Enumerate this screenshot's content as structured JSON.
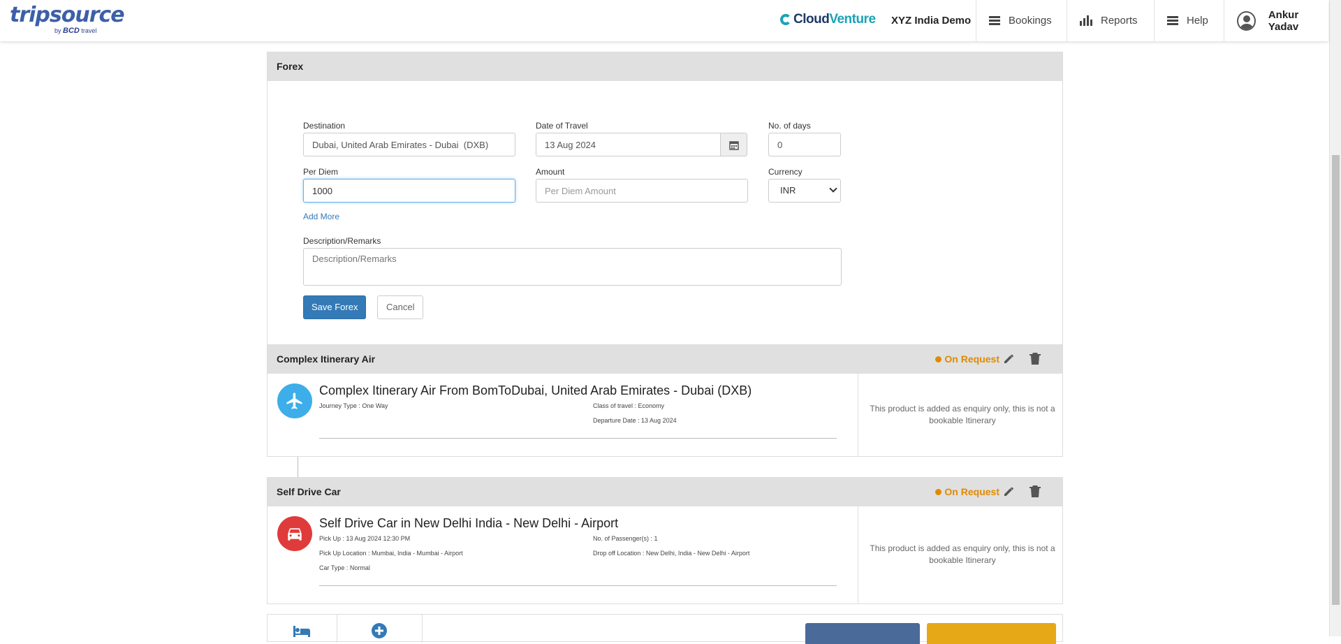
{
  "header": {
    "logo_main": "tripsource",
    "logo_by": "by",
    "logo_bcd": "BCD",
    "logo_travel": "travel",
    "brand_cloud": "Cloud",
    "brand_venture": "Venture",
    "company": "XYZ India Demo",
    "nav": {
      "bookings": "Bookings",
      "reports": "Reports",
      "help": "Help",
      "user": "Ankur Yadav"
    }
  },
  "forex": {
    "title": "Forex",
    "destination_label": "Destination",
    "destination_value": "Dubai, United Arab Emirates - Dubai  (DXB)",
    "date_label": "Date of Travel",
    "date_value": "13 Aug 2024",
    "days_label": "No. of days",
    "days_value": "0",
    "perdiem_label": "Per Diem",
    "perdiem_value": "1000",
    "amount_label": "Amount",
    "amount_placeholder": "Per Diem Amount",
    "currency_label": "Currency",
    "currency_value": "INR",
    "add_more": "Add More",
    "remarks_label": "Description/Remarks",
    "remarks_placeholder": "Description/Remarks",
    "save_label": "Save Forex",
    "cancel_label": "Cancel"
  },
  "air": {
    "section": "Complex Itinerary Air",
    "status": "On Request",
    "title": "Complex Itinerary Air From BomToDubai, United Arab Emirates - Dubai (DXB)",
    "journey_type": "Journey Type : One Way",
    "class": "Class of travel : Economy",
    "departure": "Departure Date : 13 Aug 2024",
    "note": "This product is added as enquiry only, this is not a bookable Itinerary"
  },
  "car": {
    "section": "Self Drive Car",
    "status": "On Request",
    "title": "Self Drive Car in New Delhi India - New Delhi - Airport",
    "pickup": "Pick Up : 13 Aug 2024 12:30 PM",
    "passengers": "No. of Passenger(s) : 1",
    "pickup_location": "Pick Up Location : Mumbai, India - Mumbai - Airport",
    "dropoff_location": "Drop off Location : New Delhi, India - New Delhi - Airport",
    "car_type": "Car Type : Normal",
    "note": "This product is added as enquiry only, this is not a bookable Itinerary"
  },
  "colors": {
    "primary": "#337ab7",
    "status": "#e08a00",
    "air_icon": "#3daee9",
    "car_icon": "#e03b3b"
  }
}
